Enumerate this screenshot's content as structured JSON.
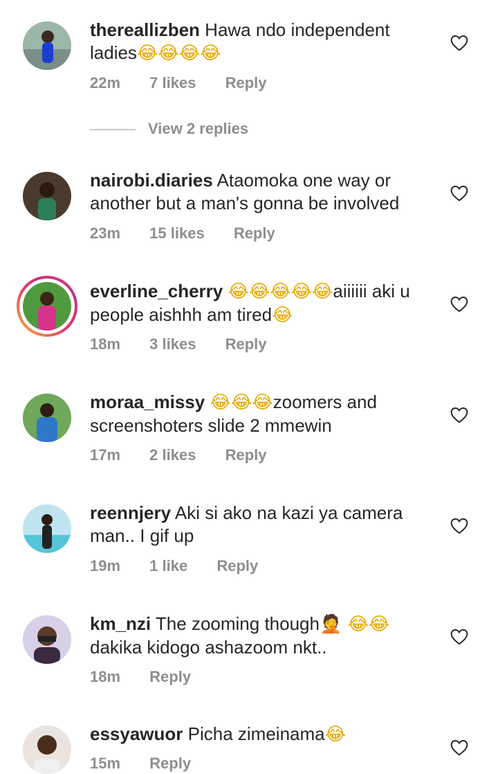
{
  "comments": [
    {
      "username": "thereallizben",
      "text": "Hawa ndo independent ladies",
      "emoji": "😂😂😂😂",
      "time": "22m",
      "likes": "7 likes",
      "reply": "Reply"
    },
    {
      "username": "nairobi.diaries",
      "text": "Ataomoka one way or another but a man's gonna be involved",
      "time": "23m",
      "likes": "15 likes",
      "reply": "Reply"
    },
    {
      "username": "everline_cherry",
      "emoji_lead": "😂😂😂😂😂",
      "text": "aiiiiii aki u people aishhh am tired",
      "emoji": "😂",
      "time": "18m",
      "likes": "3 likes",
      "reply": "Reply"
    },
    {
      "username": "moraa_missy",
      "emoji_lead": "😂😂😂",
      "text": "zoomers and screenshoters slide 2 mmewin",
      "time": "17m",
      "likes": "2 likes",
      "reply": "Reply"
    },
    {
      "username": "reennjery",
      "text": "Aki si ako na kazi ya camera man.. I gif up",
      "time": "19m",
      "likes": "1 like",
      "reply": "Reply"
    },
    {
      "username": "km_nzi",
      "text": "The zooming though",
      "emoji": "🤦 😂😂",
      "text2": "dakika kidogo ashazoom nkt..",
      "time": "18m",
      "reply": "Reply"
    },
    {
      "username": "essyawuor",
      "text": "Picha zimeinama",
      "emoji": "😂",
      "time": "15m",
      "reply": "Reply"
    }
  ],
  "view_replies": "View 2 replies"
}
